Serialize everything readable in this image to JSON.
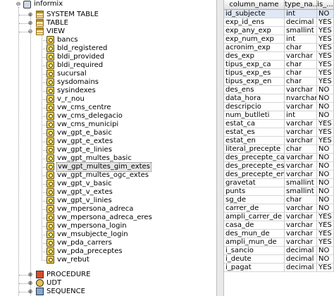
{
  "tree": {
    "root_label": "informix",
    "system_table_label": "SYSTEM TABLE",
    "table_label": "TABLE",
    "view_label": "VIEW",
    "views": [
      "bancs",
      "bld_registered",
      "bldi_provided",
      "bldi_required",
      "sucursal",
      "sysdomains",
      "sysindexes",
      "v_r_nou",
      "vw_cms_centre",
      "vw_cms_delegacio",
      "vw_cms_municipi",
      "vw_gpt_e_basic",
      "vw_gpt_e_extes",
      "vw_gpt_e_linies",
      "vw_gpt_multes_basic",
      "vw_gpt_multes_gim_extes",
      "vw_gpt_multes_ogc_extes",
      "vw_gpt_v_basic",
      "vw_gpt_v_extes",
      "vw_gpt_v_linies",
      "vw_mpersona_adreca",
      "vw_mpersona_adreca_eres",
      "vw_mpersona_login",
      "vw_msubjecte_login",
      "vw_pda_carrers",
      "vw_pda_preceptes",
      "vw_rebut"
    ],
    "selected_view": "vw_gpt_multes_gim_extes",
    "procedure_label": "PROCEDURE",
    "udt_label": "UDT",
    "sequence_label": "SEQUENCE"
  },
  "grid": {
    "columns": [
      "column_name",
      "type_na...",
      "is_..."
    ],
    "rows": [
      [
        "id_subjecte",
        "int",
        "NO"
      ],
      [
        "exp_id_ens",
        "decimal",
        "YES"
      ],
      [
        "exp_any_exp",
        "smallint",
        "YES"
      ],
      [
        "exp_num_exp",
        "int",
        "YES"
      ],
      [
        "acronim_exp",
        "char",
        "YES"
      ],
      [
        "des_exp",
        "varchar",
        "YES"
      ],
      [
        "tipus_exp_ca",
        "char",
        "YES"
      ],
      [
        "tipus_exp_es",
        "char",
        "YES"
      ],
      [
        "tipus_exp_en",
        "char",
        "YES"
      ],
      [
        "des_ens",
        "varchar",
        "NO"
      ],
      [
        "data_hora",
        "nvarchar",
        "NO"
      ],
      [
        "descripcio",
        "varchar",
        "NO"
      ],
      [
        "num_butlleti",
        "int",
        "NO"
      ],
      [
        "estat_ca",
        "varchar",
        "YES"
      ],
      [
        "estat_es",
        "varchar",
        "YES"
      ],
      [
        "estat_en",
        "varchar",
        "YES"
      ],
      [
        "literal_precepte",
        "char",
        "NO"
      ],
      [
        "des_precepte_ca",
        "varchar",
        "NO"
      ],
      [
        "des_precepte_es",
        "varchar",
        "NO"
      ],
      [
        "des_precepte_en",
        "varchar",
        "NO"
      ],
      [
        "gravetat",
        "smallint",
        "NO"
      ],
      [
        "punts",
        "smallint",
        "NO"
      ],
      [
        "sg_de",
        "char",
        "NO"
      ],
      [
        "carrer_de",
        "varchar",
        "NO"
      ],
      [
        "ampli_carrer_de",
        "varchar",
        "YES"
      ],
      [
        "casa_de",
        "varchar",
        "YES"
      ],
      [
        "des_mun_de",
        "varchar",
        "YES"
      ],
      [
        "ampli_mun_de",
        "varchar",
        "YES"
      ],
      [
        "i_sancio",
        "decimal",
        "NO"
      ],
      [
        "i_deute",
        "decimal",
        "NO"
      ],
      [
        "i_pagat",
        "decimal",
        "YES"
      ]
    ],
    "selected_row": 0
  }
}
